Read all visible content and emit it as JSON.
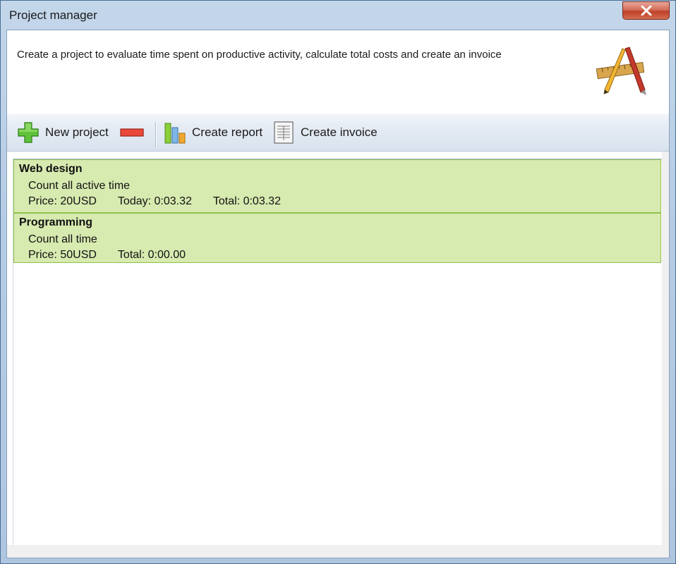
{
  "window": {
    "title": "Project manager",
    "close_glyph": "✕"
  },
  "header": {
    "description": "Create a project to evaluate time spent on productive activity, calculate total costs and create an invoice",
    "logo_icon": "design-tools-icon"
  },
  "toolbar": {
    "new_project_label": "New project",
    "remove_icon": "minus-icon",
    "create_report_label": "Create report",
    "create_invoice_label": "Create invoice"
  },
  "projects": [
    {
      "name": "Web design",
      "mode": "Count all active time",
      "price": "Price: 20USD",
      "today": "Today: 0:03.32",
      "total": "Total: 0:03.32"
    },
    {
      "name": "Programming",
      "mode": "Count all time",
      "price": "Price: 50USD",
      "total": "Total: 0:00.00"
    }
  ],
  "colors": {
    "project_bg": "#d7eab0",
    "project_border": "#8fc24a",
    "close_red": "#c0412a"
  }
}
